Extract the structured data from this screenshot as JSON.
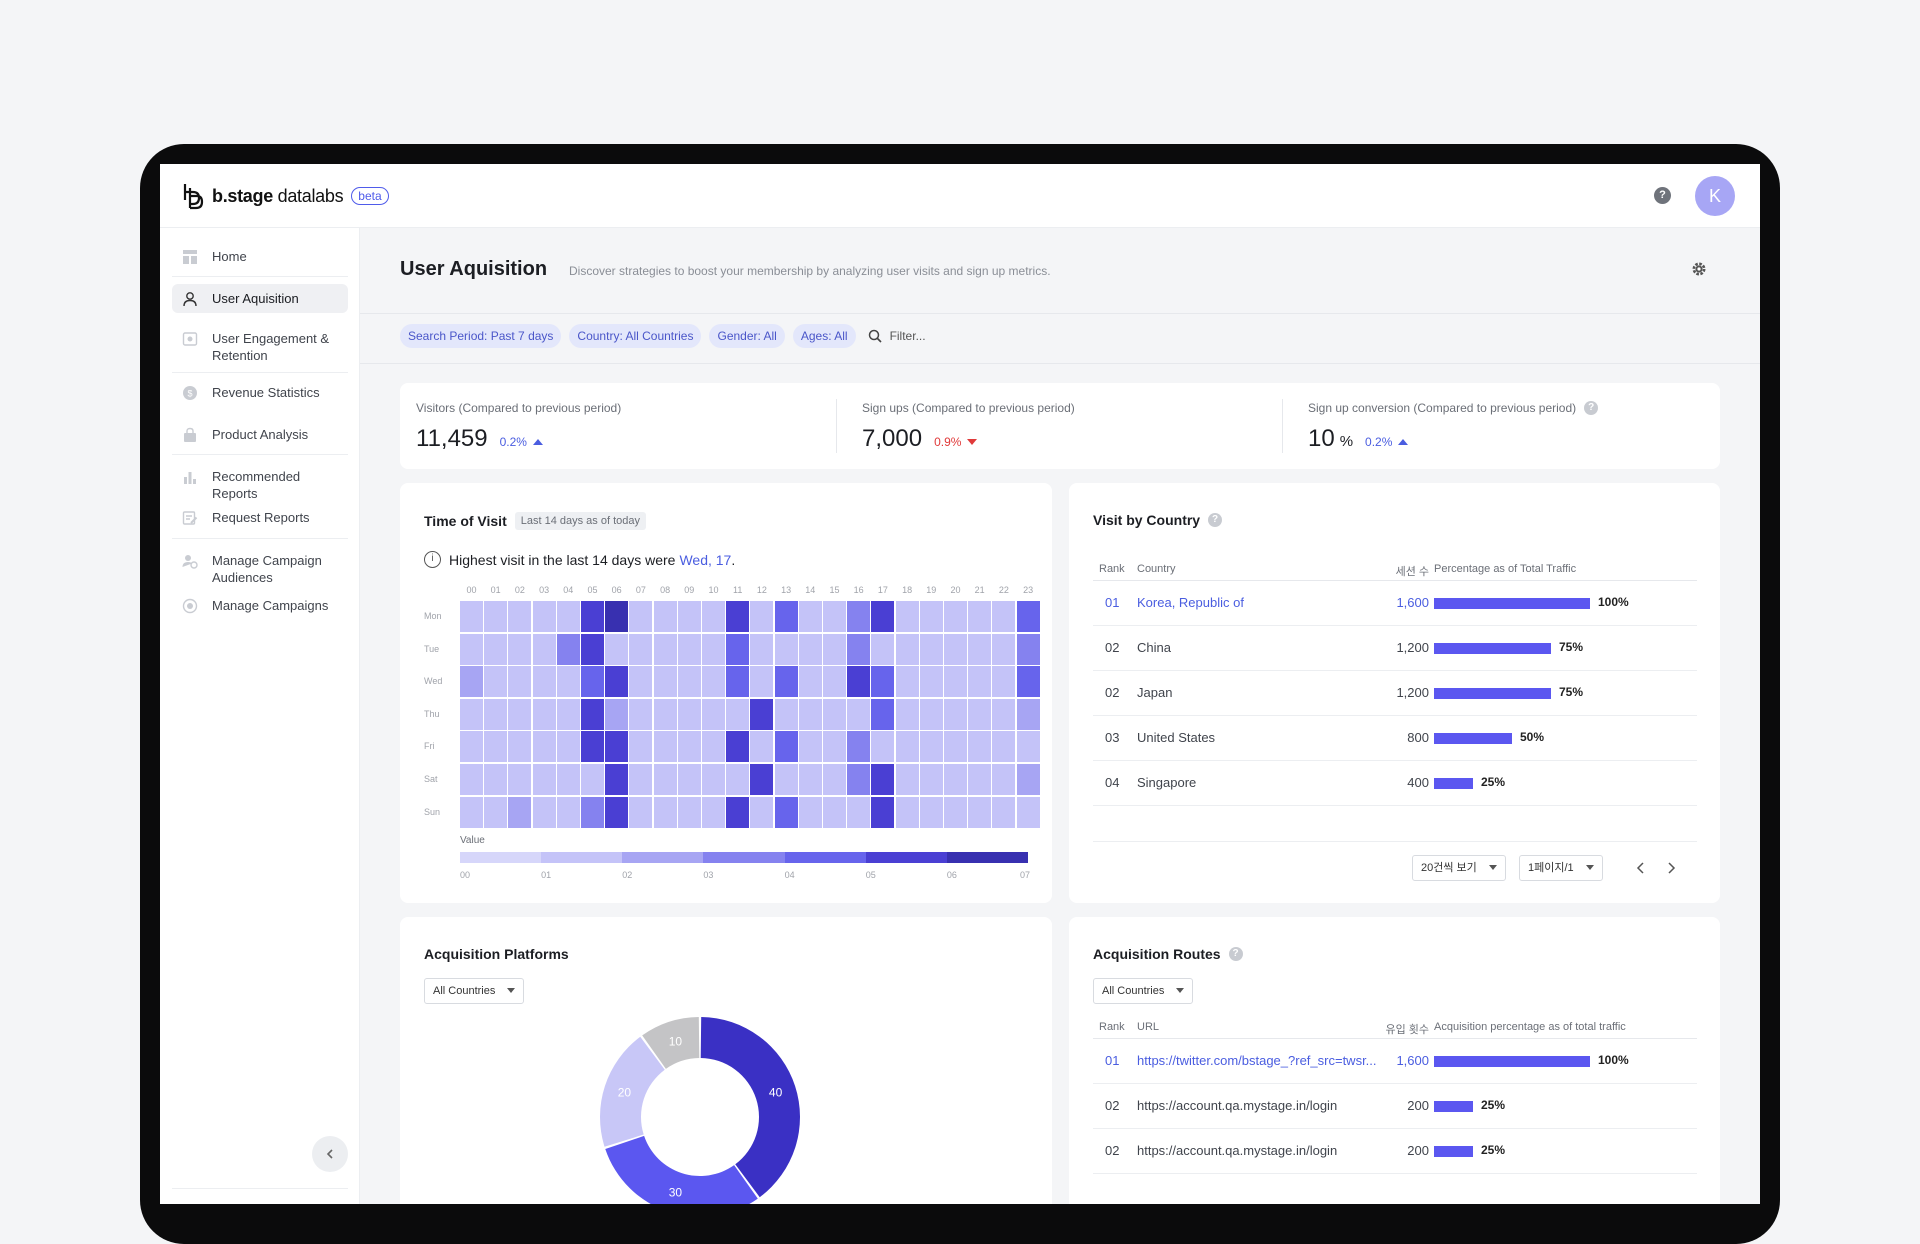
{
  "app": {
    "logo_text_bold": "b.stage",
    "logo_text_light": " datalabs",
    "beta_label": "beta",
    "help_label": "?",
    "avatar_initial": "K"
  },
  "sidebar": {
    "items": [
      {
        "label": "Home",
        "icon": "layout-icon"
      },
      {
        "label": "User Aquisition",
        "icon": "user-icon",
        "active": true
      },
      {
        "label": "User Engagement & Retention",
        "icon": "engagement-icon"
      },
      {
        "label": "Revenue Statistics",
        "icon": "dollar-icon"
      },
      {
        "label": "Product Analysis",
        "icon": "bag-icon"
      },
      {
        "label": "Recommended Reports",
        "icon": "bar-chart-icon"
      },
      {
        "label": "Request Reports",
        "icon": "edit-doc-icon"
      },
      {
        "label": "Manage Campaign Audiences",
        "icon": "audience-icon"
      },
      {
        "label": "Manage Campaigns",
        "icon": "target-icon"
      }
    ],
    "collapse_icon": "chevron-left-icon"
  },
  "header": {
    "title": "User Aquisition",
    "description": "Discover strategies to boost your membership by analyzing user visits and sign up metrics."
  },
  "filters": {
    "chips": [
      "Search Period: Past 7 days",
      "Country: All Countries",
      "Gender: All",
      "Ages: All"
    ],
    "search_placeholder": "Filter..."
  },
  "kpis": [
    {
      "label": "Visitors (Compared to previous period)",
      "value": "11,459",
      "unit": "",
      "delta": "0.2%",
      "direction": "up"
    },
    {
      "label": "Sign ups (Compared to previous period)",
      "value": "7,000",
      "unit": "",
      "delta": "0.9%",
      "direction": "down"
    },
    {
      "label": "Sign up conversion (Compared to previous period)",
      "value": "10",
      "unit": "%",
      "delta": "0.2%",
      "direction": "up"
    }
  ],
  "time_of_visit": {
    "title": "Time of Visit",
    "tag": "Last 14 days as of today",
    "highlight_text": "Highest visit in the last 14 days were",
    "highlight_value": "Wed, 17",
    "highlight_end": ".",
    "hours": [
      "00",
      "01",
      "02",
      "03",
      "04",
      "05",
      "06",
      "07",
      "08",
      "09",
      "10",
      "11",
      "12",
      "13",
      "14",
      "15",
      "16",
      "17",
      "18",
      "19",
      "20",
      "21",
      "22",
      "23"
    ],
    "days": [
      "Mon",
      "Tue",
      "Wed",
      "Thu",
      "Fri",
      "Sat",
      "Sun"
    ],
    "levels": [
      [
        1,
        1,
        1,
        1,
        1,
        5,
        6,
        1,
        1,
        1,
        1,
        5,
        1,
        4,
        1,
        1,
        3,
        5,
        1,
        1,
        1,
        1,
        1,
        4
      ],
      [
        1,
        1,
        1,
        1,
        3,
        5,
        1,
        1,
        1,
        1,
        1,
        4,
        1,
        1,
        1,
        1,
        3,
        1,
        1,
        1,
        1,
        1,
        1,
        3
      ],
      [
        2,
        1,
        1,
        1,
        1,
        4,
        5,
        1,
        1,
        1,
        1,
        4,
        1,
        4,
        1,
        1,
        5,
        4,
        1,
        1,
        1,
        1,
        1,
        4
      ],
      [
        1,
        1,
        1,
        1,
        1,
        5,
        2,
        1,
        1,
        1,
        1,
        1,
        5,
        1,
        1,
        1,
        1,
        4,
        1,
        1,
        1,
        1,
        1,
        2
      ],
      [
        1,
        1,
        1,
        1,
        1,
        5,
        5,
        1,
        1,
        1,
        1,
        5,
        1,
        4,
        1,
        1,
        3,
        1,
        1,
        1,
        1,
        1,
        1,
        1
      ],
      [
        1,
        1,
        1,
        1,
        1,
        1,
        5,
        1,
        1,
        1,
        1,
        1,
        5,
        1,
        1,
        1,
        3,
        5,
        1,
        1,
        1,
        1,
        1,
        2
      ],
      [
        1,
        1,
        2,
        1,
        1,
        3,
        5,
        1,
        1,
        1,
        1,
        5,
        1,
        4,
        1,
        1,
        1,
        5,
        1,
        1,
        1,
        1,
        1,
        1
      ]
    ],
    "palette": [
      "#d6d6fa",
      "#c4c3f8",
      "#a7a5f3",
      "#8582ef",
      "#6764ec",
      "#4a3fd3",
      "#3830b0"
    ],
    "legend_label": "Value",
    "legend_ticks": [
      "00",
      "01",
      "02",
      "03",
      "04",
      "05",
      "06",
      "07"
    ]
  },
  "visit_by_country": {
    "title": "Visit by Country",
    "columns": [
      "Rank",
      "Country",
      "세션 수",
      "Percentage as of Total Traffic"
    ],
    "rows": [
      {
        "rank": "01",
        "country": "Korea, Republic of",
        "sessions": "1,600",
        "pct": 100,
        "pct_label": "100%"
      },
      {
        "rank": "02",
        "country": "China",
        "sessions": "1,200",
        "pct": 75,
        "pct_label": "75%"
      },
      {
        "rank": "02",
        "country": "Japan",
        "sessions": "1,200",
        "pct": 75,
        "pct_label": "75%"
      },
      {
        "rank": "03",
        "country": "United States",
        "sessions": "800",
        "pct": 50,
        "pct_label": "50%"
      },
      {
        "rank": "04",
        "country": "Singapore",
        "sessions": "400",
        "pct": 25,
        "pct_label": "25%"
      }
    ],
    "page_size_label": "20건씩 보기",
    "page_label": "1페이지/1"
  },
  "acquisition_platforms": {
    "title": "Acquisition Platforms",
    "dropdown": "All Countries",
    "slices": [
      {
        "value": 40,
        "label": "40",
        "color": "#3a30c4"
      },
      {
        "value": 30,
        "label": "30",
        "color": "#5b57f0"
      },
      {
        "value": 20,
        "label": "20",
        "color": "#c8c7f7"
      },
      {
        "value": 10,
        "label": "10",
        "color": "#c4c4c6"
      }
    ]
  },
  "acquisition_routes": {
    "title": "Acquisition Routes",
    "dropdown": "All Countries",
    "columns": [
      "Rank",
      "URL",
      "유입 횟수",
      "Acquisition percentage as of total traffic"
    ],
    "rows": [
      {
        "rank": "01",
        "url": "https://twitter.com/bstage_?ref_src=twsr...",
        "count": "1,600",
        "pct": 100,
        "pct_label": "100%"
      },
      {
        "rank": "02",
        "url": "https://account.qa.mystage.in/login",
        "count": "200",
        "pct": 25,
        "pct_label": "25%"
      },
      {
        "rank": "02",
        "url": "https://account.qa.mystage.in/login",
        "count": "200",
        "pct": 25,
        "pct_label": "25%"
      }
    ]
  }
}
